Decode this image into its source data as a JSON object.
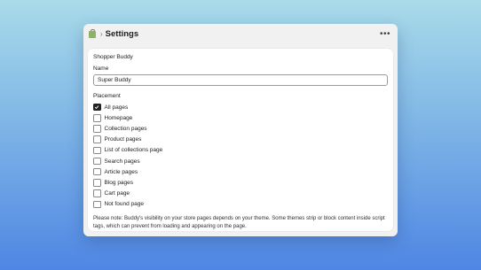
{
  "header": {
    "title": "Settings",
    "app_icon": "shopping-bag-icon",
    "separator_icon": "chevron-right-icon",
    "more_icon": "ellipsis-icon"
  },
  "card": {
    "section_title": "Shopper Buddy",
    "name_label": "Name",
    "name_value": "Super Buddy",
    "placement_label": "Placement",
    "options": [
      {
        "label": "All pages",
        "checked": true
      },
      {
        "label": "Homepage",
        "checked": false
      },
      {
        "label": "Collection pages",
        "checked": false
      },
      {
        "label": "Product pages",
        "checked": false
      },
      {
        "label": "List of collections page",
        "checked": false
      },
      {
        "label": "Search pages",
        "checked": false
      },
      {
        "label": "Article pages",
        "checked": false
      },
      {
        "label": "Blog pages",
        "checked": false
      },
      {
        "label": "Cart page",
        "checked": false
      },
      {
        "label": "Not found page",
        "checked": false
      }
    ],
    "note": "Please note: Buddy's visibility on your store pages depends on your theme. Some themes strip or block content inside script tags, which can prevent from loading and appearing on the page."
  }
}
